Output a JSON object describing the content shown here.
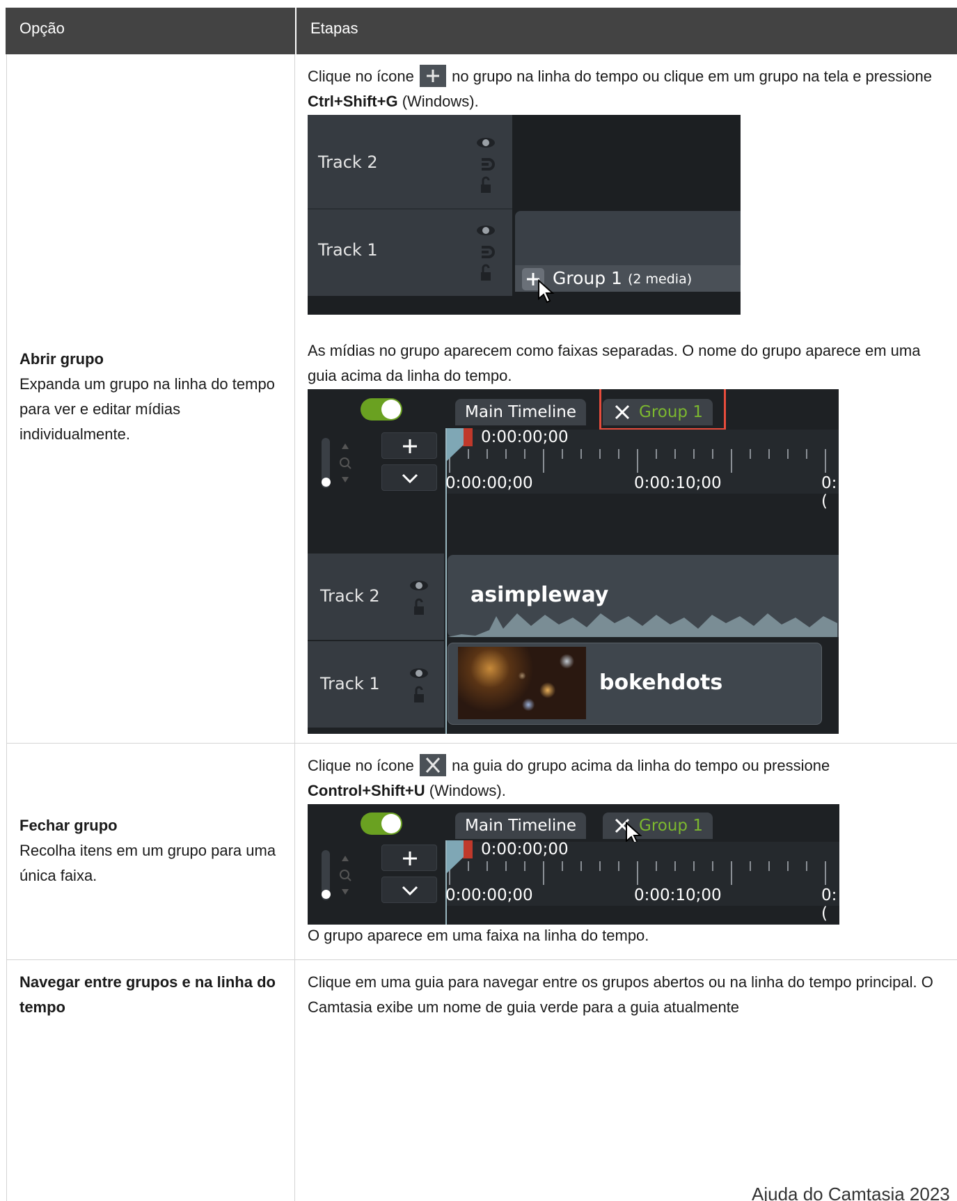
{
  "header": {
    "col_option": "Opção",
    "col_steps": "Etapas"
  },
  "rows": [
    {
      "title": "Abrir grupo",
      "desc": "Expanda um grupo na linha do tempo para ver e editar mídias individualmente.",
      "step1_a": "Clique no ícone",
      "step1_b": "no grupo na linha do tempo ou clique em um grupo na tela e pressione",
      "step1_key": "Ctrl+Shift+G",
      "step1_c": "(Windows).",
      "step2": "As mídias no grupo aparecem como faixas separadas. O nome do grupo aparece em uma guia acima da linha do tempo."
    },
    {
      "title": "Fechar grupo",
      "desc": "Recolha itens em um grupo para uma única faixa.",
      "step1_a": "Clique no ícone",
      "step1_b": "na guia do grupo acima da linha do tempo ou pressione",
      "step1_key": "Control+Shift+U",
      "step1_c": "(Windows).",
      "step2": "O grupo aparece em uma faixa na linha do tempo."
    },
    {
      "title": "Navegar entre grupos e na linha do tempo",
      "step1": "Clique em uma guia para navegar entre os grupos abertos ou na linha do tempo principal. O Camtasia exibe um nome de guia verde para a guia atualmente"
    }
  ],
  "screens": {
    "shot1": {
      "track2": "Track 2",
      "track1": "Track 1",
      "group_label": "Group 1",
      "group_count": "(2 media)"
    },
    "shot2": {
      "tab_main": "Main Timeline",
      "tab_group": "Group 1",
      "playhead_time": "0:00:00;00",
      "tick0": "0:00:00;00",
      "tick1": "0:00:10;00",
      "tick2": "0:(",
      "track2": "Track 2",
      "track1": "Track 1",
      "clip2": "asimpleway",
      "clip1": "bokehdots"
    },
    "shot3": {
      "tab_main": "Main Timeline",
      "tab_group": "Group 1",
      "playhead_time": "0:00:00;00",
      "tick0": "0:00:00;00",
      "tick1": "0:00:10;00",
      "tick2": "0:("
    }
  },
  "colors": {
    "header_bg": "#434343",
    "group_tab_green": "#7cb82f",
    "highlight_red": "#e74c3c",
    "toggle_green": "#6aa121"
  },
  "footer": "Ajuda do Camtasia 2023"
}
